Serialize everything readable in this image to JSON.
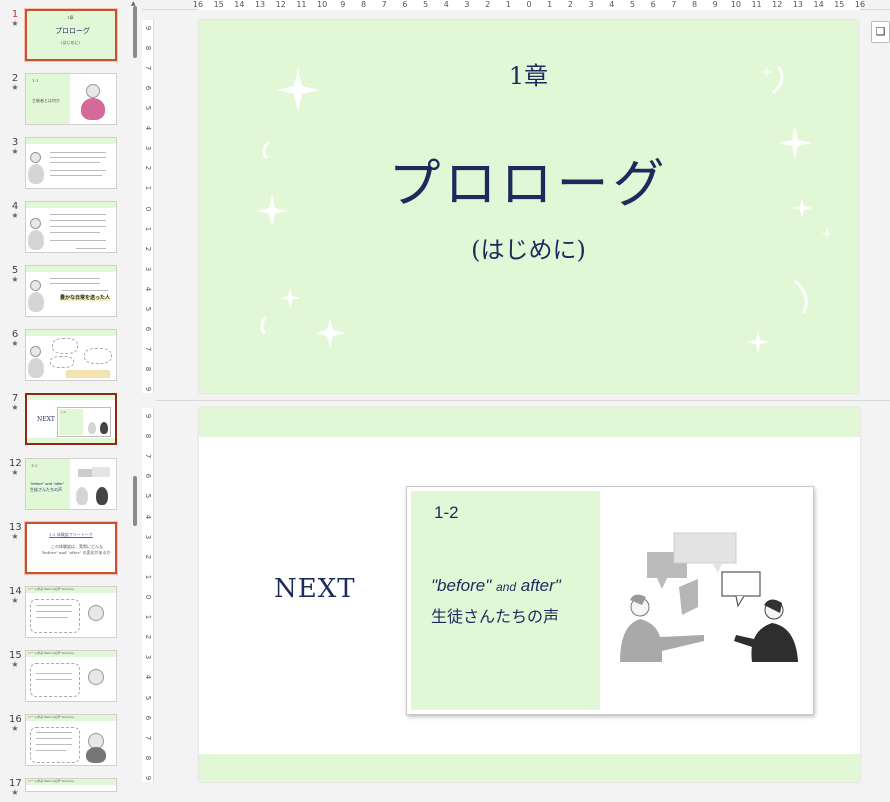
{
  "thumbnails": [
    {
      "num": "1",
      "star": "★"
    },
    {
      "num": "2",
      "star": "★"
    },
    {
      "num": "3",
      "star": "★"
    },
    {
      "num": "4",
      "star": "★"
    },
    {
      "num": "5",
      "star": "★"
    },
    {
      "num": "6",
      "star": "★"
    },
    {
      "num": "7",
      "star": "★"
    },
    {
      "num": "12",
      "star": "★"
    },
    {
      "num": "13",
      "star": "★"
    },
    {
      "num": "14",
      "star": "★"
    },
    {
      "num": "15",
      "star": "★"
    },
    {
      "num": "16",
      "star": "★"
    },
    {
      "num": "17",
      "star": "★"
    }
  ],
  "thumb_texts": {
    "t1_chapter": "1章",
    "t1_title": "プロローグ",
    "t1_sub": "(はじめに)",
    "t2_num": "1-1",
    "t2_text": "主催者とは何か",
    "t5_text": "豊かな日常を送った人",
    "t7_next": "NEXT",
    "t7_num": "1-2",
    "t12_num": "1-2",
    "t12_ba": "\"before\" and \"after\"",
    "t12_voice": "生徒さんたちの声",
    "t13_title": "1-2 体験談フリートーク",
    "t13_body1": "この体験談は、実際にどんな",
    "t13_body2": "\"before\" and \"after\" の変化があるか",
    "t14_head": "ハート歩み\"Beforeの声\"(before)",
    "t15_head": "ハート歩み\"Beforeの声\"(before)",
    "t16_head": "ハート歩み\"Beforeの声\"(before)",
    "t17_head": "ハート歩み\"Beforeの声\"(before)"
  },
  "ruler": {
    "h_numbers": [
      "16",
      "15",
      "14",
      "13",
      "12",
      "11",
      "10",
      "9",
      "8",
      "7",
      "6",
      "5",
      "4",
      "3",
      "2",
      "1",
      "0",
      "1",
      "2",
      "3",
      "4",
      "5",
      "6",
      "7",
      "8",
      "9",
      "10",
      "11",
      "12",
      "13",
      "14",
      "15",
      "16"
    ],
    "v1_numbers": [
      "9",
      "8",
      "7",
      "6",
      "5",
      "4",
      "3",
      "2",
      "1",
      "0",
      "1",
      "2",
      "3",
      "4",
      "5",
      "6",
      "7",
      "8",
      "9"
    ],
    "v2_numbers": [
      "9",
      "8",
      "7",
      "6",
      "5",
      "4",
      "3",
      "2",
      "1",
      "0",
      "1",
      "2",
      "3",
      "4",
      "5",
      "6",
      "7",
      "8",
      "9"
    ]
  },
  "slide1": {
    "chapter": "1章",
    "title": "プロローグ",
    "subtitle": "(はじめに)"
  },
  "slide2": {
    "next": "NEXT",
    "card_num": "1-2",
    "before": "\"before\"",
    "and": "and",
    "after": "after\"",
    "voice": "生徒さんたちの声"
  },
  "bookmark_icon": "bookmark-icon",
  "colors": {
    "accent_green": "#e2f7d6",
    "title_navy": "#1d2b5c",
    "selection": "#c8502d"
  }
}
